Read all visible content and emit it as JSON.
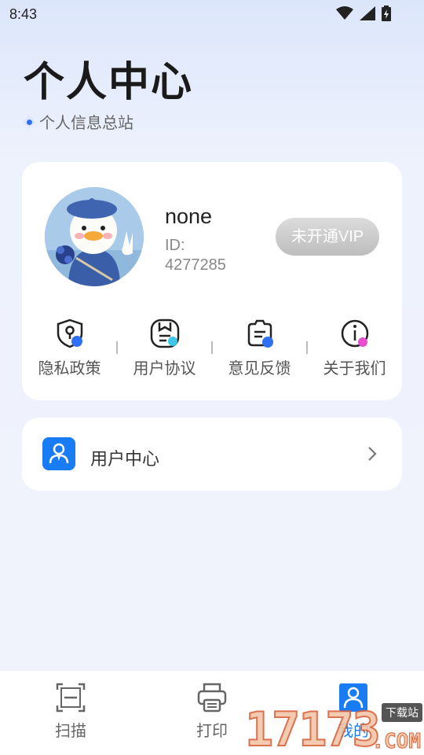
{
  "status_bar": {
    "time": "8:43",
    "icons": [
      "wifi-icon",
      "signal-icon",
      "battery-icon"
    ]
  },
  "header": {
    "title": "个人中心",
    "subtitle": "个人信息总站"
  },
  "profile": {
    "username": "none",
    "id_text": "ID:\n4277285",
    "vip_label": "未开通VIP"
  },
  "shortcuts": [
    {
      "label": "隐私政策",
      "icon": "shield-icon",
      "accent": "#2f6ff2"
    },
    {
      "label": "用户协议",
      "icon": "document-icon",
      "accent": "#3cc6e8"
    },
    {
      "label": "意见反馈",
      "icon": "feedback-icon",
      "accent": "#2f6ff2"
    },
    {
      "label": "关于我们",
      "icon": "info-icon",
      "accent": "#e64ecf"
    }
  ],
  "menu": {
    "user_center_label": "用户中心",
    "icon": "user-icon"
  },
  "bottom_nav": [
    {
      "label": "扫描",
      "icon": "scan-icon",
      "active": false
    },
    {
      "label": "打印",
      "icon": "printer-icon",
      "active": false
    },
    {
      "label": "我的",
      "icon": "profile-icon",
      "active": true
    }
  ],
  "watermark": {
    "number": "17173",
    "tag": "下载站",
    "suffix": ".COM"
  },
  "colors": {
    "accent": "#1a7cf5",
    "background": "#eef2fc",
    "vip_disabled": "#c8c8c8"
  }
}
